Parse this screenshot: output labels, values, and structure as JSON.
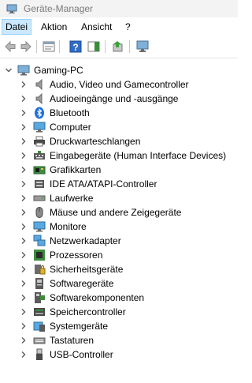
{
  "window": {
    "title": "Geräte-Manager"
  },
  "menu": [
    "Datei",
    "Aktion",
    "Ansicht",
    "?"
  ],
  "toolbar": [
    "back",
    "forward",
    "properties",
    "console-tree",
    "help",
    "action-pane",
    "update-driver",
    "scan-hardware"
  ],
  "tree": {
    "root": "Gaming-PC",
    "categories": [
      "Audio, Video und Gamecontroller",
      "Audioeingänge und -ausgänge",
      "Bluetooth",
      "Computer",
      "Druckwarteschlangen",
      "Eingabegeräte (Human Interface Devices)",
      "Grafikkarten",
      "IDE ATA/ATAPI-Controller",
      "Laufwerke",
      "Mäuse und andere Zeigegeräte",
      "Monitore",
      "Netzwerkadapter",
      "Prozessoren",
      "Sicherheitsgeräte",
      "Softwaregeräte",
      "Softwarekomponenten",
      "Speichercontroller",
      "Systemgeräte",
      "Tastaturen",
      "USB-Controller"
    ]
  },
  "colors": {
    "accent": "#0078d7",
    "menu_highlight": "#cce8ff",
    "chevron": "#5a5a5a"
  }
}
